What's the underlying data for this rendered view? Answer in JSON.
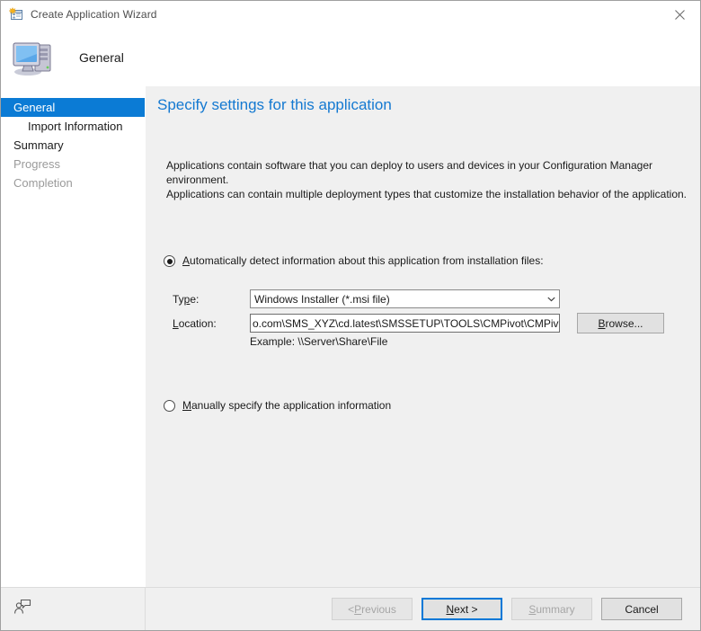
{
  "window": {
    "title": "Create Application Wizard",
    "titlebar_icon": "new-application-icon",
    "close_icon": "close-icon"
  },
  "header": {
    "icon": "computer-icon",
    "title": "General"
  },
  "sidebar": {
    "items": [
      {
        "label": "General",
        "state": "selected"
      },
      {
        "label": "Import Information",
        "state": "indent"
      },
      {
        "label": "Summary",
        "state": "normal"
      },
      {
        "label": "Progress",
        "state": "disabled"
      },
      {
        "label": "Completion",
        "state": "disabled"
      }
    ]
  },
  "main": {
    "heading": "Specify settings for this application",
    "description_line1": "Applications contain software that you can deploy to users and devices in your Configuration Manager environment.",
    "description_line2": "Applications can contain multiple deployment types that customize the installation behavior of the application.",
    "auto_radio": {
      "accelerator": "A",
      "label_rest": "utomatically detect information about this application from installation files:",
      "checked": true
    },
    "type_field": {
      "label_pre": "Ty",
      "label_accelerator": "p",
      "label_post": "e:",
      "value": "Windows Installer (*.msi file)",
      "arrow_icon": "chevron-down-icon"
    },
    "location_field": {
      "label_accelerator": "L",
      "label_rest": "ocation:",
      "value": "o.com\\SMS_XYZ\\cd.latest\\SMSSETUP\\TOOLS\\CMPivot\\CMPivot.msi",
      "browse_accelerator": "B",
      "browse_rest": "rowse...",
      "hint": "Example: \\\\Server\\Share\\File"
    },
    "manual_radio": {
      "accelerator": "M",
      "label_rest": "anually specify the application information",
      "checked": false
    }
  },
  "footer": {
    "feedback_icon": "feedback-person-icon",
    "buttons": [
      {
        "pre": "< ",
        "accelerator": "P",
        "post": "revious",
        "state": "disabled"
      },
      {
        "pre": "",
        "accelerator": "N",
        "post": "ext >",
        "state": "focused"
      },
      {
        "pre": "",
        "accelerator": "S",
        "post": "ummary",
        "state": "disabled"
      },
      {
        "pre": "",
        "accelerator": "",
        "post": "Cancel",
        "state": "normal"
      }
    ]
  },
  "colors": {
    "accent": "#1479d1",
    "selection": "#0b7bd5",
    "focus": "#0078d7"
  }
}
